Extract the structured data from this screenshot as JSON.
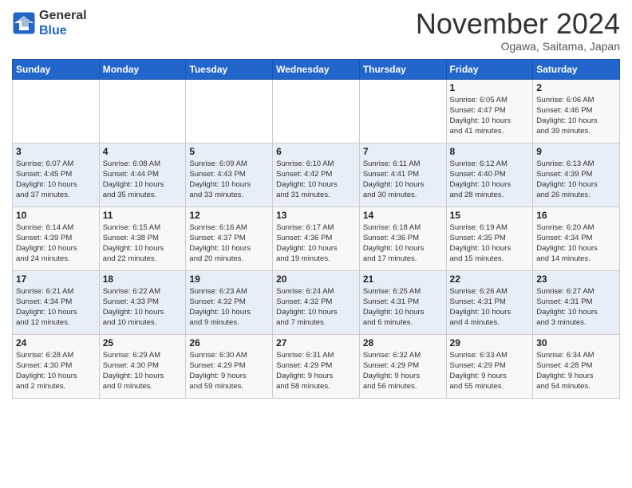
{
  "header": {
    "logo_line1": "General",
    "logo_line2": "Blue",
    "month": "November 2024",
    "location": "Ogawa, Saitama, Japan"
  },
  "weekdays": [
    "Sunday",
    "Monday",
    "Tuesday",
    "Wednesday",
    "Thursday",
    "Friday",
    "Saturday"
  ],
  "weeks": [
    [
      {
        "day": "",
        "info": ""
      },
      {
        "day": "",
        "info": ""
      },
      {
        "day": "",
        "info": ""
      },
      {
        "day": "",
        "info": ""
      },
      {
        "day": "",
        "info": ""
      },
      {
        "day": "1",
        "info": "Sunrise: 6:05 AM\nSunset: 4:47 PM\nDaylight: 10 hours\nand 41 minutes."
      },
      {
        "day": "2",
        "info": "Sunrise: 6:06 AM\nSunset: 4:46 PM\nDaylight: 10 hours\nand 39 minutes."
      }
    ],
    [
      {
        "day": "3",
        "info": "Sunrise: 6:07 AM\nSunset: 4:45 PM\nDaylight: 10 hours\nand 37 minutes."
      },
      {
        "day": "4",
        "info": "Sunrise: 6:08 AM\nSunset: 4:44 PM\nDaylight: 10 hours\nand 35 minutes."
      },
      {
        "day": "5",
        "info": "Sunrise: 6:09 AM\nSunset: 4:43 PM\nDaylight: 10 hours\nand 33 minutes."
      },
      {
        "day": "6",
        "info": "Sunrise: 6:10 AM\nSunset: 4:42 PM\nDaylight: 10 hours\nand 31 minutes."
      },
      {
        "day": "7",
        "info": "Sunrise: 6:11 AM\nSunset: 4:41 PM\nDaylight: 10 hours\nand 30 minutes."
      },
      {
        "day": "8",
        "info": "Sunrise: 6:12 AM\nSunset: 4:40 PM\nDaylight: 10 hours\nand 28 minutes."
      },
      {
        "day": "9",
        "info": "Sunrise: 6:13 AM\nSunset: 4:39 PM\nDaylight: 10 hours\nand 26 minutes."
      }
    ],
    [
      {
        "day": "10",
        "info": "Sunrise: 6:14 AM\nSunset: 4:39 PM\nDaylight: 10 hours\nand 24 minutes."
      },
      {
        "day": "11",
        "info": "Sunrise: 6:15 AM\nSunset: 4:38 PM\nDaylight: 10 hours\nand 22 minutes."
      },
      {
        "day": "12",
        "info": "Sunrise: 6:16 AM\nSunset: 4:37 PM\nDaylight: 10 hours\nand 20 minutes."
      },
      {
        "day": "13",
        "info": "Sunrise: 6:17 AM\nSunset: 4:36 PM\nDaylight: 10 hours\nand 19 minutes."
      },
      {
        "day": "14",
        "info": "Sunrise: 6:18 AM\nSunset: 4:36 PM\nDaylight: 10 hours\nand 17 minutes."
      },
      {
        "day": "15",
        "info": "Sunrise: 6:19 AM\nSunset: 4:35 PM\nDaylight: 10 hours\nand 15 minutes."
      },
      {
        "day": "16",
        "info": "Sunrise: 6:20 AM\nSunset: 4:34 PM\nDaylight: 10 hours\nand 14 minutes."
      }
    ],
    [
      {
        "day": "17",
        "info": "Sunrise: 6:21 AM\nSunset: 4:34 PM\nDaylight: 10 hours\nand 12 minutes."
      },
      {
        "day": "18",
        "info": "Sunrise: 6:22 AM\nSunset: 4:33 PM\nDaylight: 10 hours\nand 10 minutes."
      },
      {
        "day": "19",
        "info": "Sunrise: 6:23 AM\nSunset: 4:32 PM\nDaylight: 10 hours\nand 9 minutes."
      },
      {
        "day": "20",
        "info": "Sunrise: 6:24 AM\nSunset: 4:32 PM\nDaylight: 10 hours\nand 7 minutes."
      },
      {
        "day": "21",
        "info": "Sunrise: 6:25 AM\nSunset: 4:31 PM\nDaylight: 10 hours\nand 6 minutes."
      },
      {
        "day": "22",
        "info": "Sunrise: 6:26 AM\nSunset: 4:31 PM\nDaylight: 10 hours\nand 4 minutes."
      },
      {
        "day": "23",
        "info": "Sunrise: 6:27 AM\nSunset: 4:31 PM\nDaylight: 10 hours\nand 3 minutes."
      }
    ],
    [
      {
        "day": "24",
        "info": "Sunrise: 6:28 AM\nSunset: 4:30 PM\nDaylight: 10 hours\nand 2 minutes."
      },
      {
        "day": "25",
        "info": "Sunrise: 6:29 AM\nSunset: 4:30 PM\nDaylight: 10 hours\nand 0 minutes."
      },
      {
        "day": "26",
        "info": "Sunrise: 6:30 AM\nSunset: 4:29 PM\nDaylight: 9 hours\nand 59 minutes."
      },
      {
        "day": "27",
        "info": "Sunrise: 6:31 AM\nSunset: 4:29 PM\nDaylight: 9 hours\nand 58 minutes."
      },
      {
        "day": "28",
        "info": "Sunrise: 6:32 AM\nSunset: 4:29 PM\nDaylight: 9 hours\nand 56 minutes."
      },
      {
        "day": "29",
        "info": "Sunrise: 6:33 AM\nSunset: 4:29 PM\nDaylight: 9 hours\nand 55 minutes."
      },
      {
        "day": "30",
        "info": "Sunrise: 6:34 AM\nSunset: 4:28 PM\nDaylight: 9 hours\nand 54 minutes."
      }
    ]
  ]
}
